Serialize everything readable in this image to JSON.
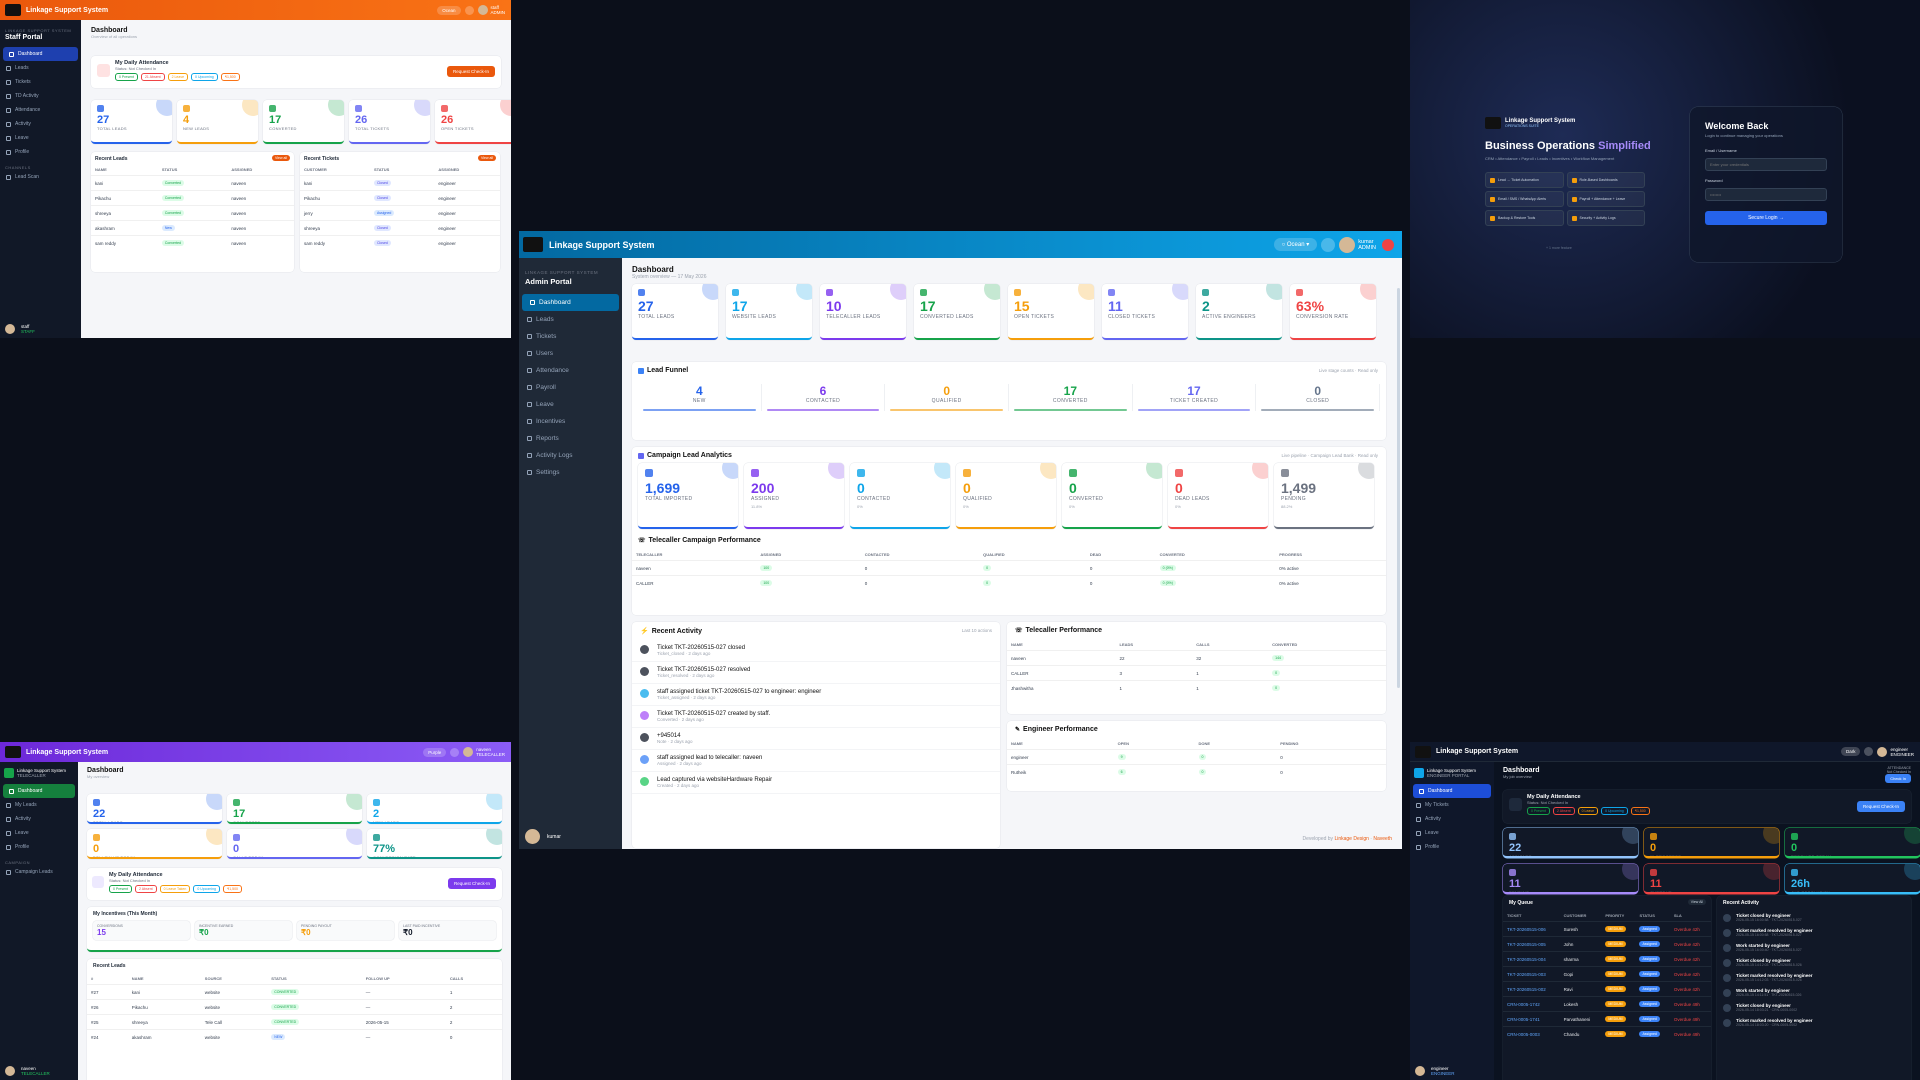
{
  "brand": "Linkage Support System",
  "staff": {
    "cap": "LINKAGE SUPPORT SYSTEM",
    "portal": "Staff Portal",
    "nav": [
      "Dashboard",
      "Leads",
      "Tickets",
      "TD Activity",
      "Attendance",
      "Activity",
      "Leave",
      "Profile"
    ],
    "nav_extra_cap": "CHANNELS",
    "nav_extra": "Lead Scan",
    "theme": "Ocean",
    "user": "staff",
    "role": "ADMIN",
    "title": "Dashboard",
    "subtitle": "Overview of all operations",
    "att_title": "My Daily Attendance",
    "att_status": "Status: Not Checked In",
    "att_chips": [
      "0 Present",
      "21 Absent",
      "2 Leave",
      "0 Upcoming",
      "₹1,500"
    ],
    "checkin": "Request Check-In",
    "stats": [
      {
        "n": "27",
        "l": "TOTAL LEADS",
        "c": "#2563eb"
      },
      {
        "n": "4",
        "l": "NEW LEADS",
        "c": "#f59e0b"
      },
      {
        "n": "17",
        "l": "CONVERTED",
        "c": "#16a34a"
      },
      {
        "n": "26",
        "l": "TOTAL TICKETS",
        "c": "#6366f1"
      },
      {
        "n": "26",
        "l": "OPEN TICKETS",
        "c": "#ef4444"
      }
    ],
    "recent_leads": "Recent Leads",
    "recent_tickets": "Recent Tickets",
    "view_all": "View all",
    "lead_cols": [
      "NAME",
      "STATUS",
      "ASSIGNED"
    ],
    "leads": [
      [
        "kani",
        "Converted",
        "naveen"
      ],
      [
        "Pikachu",
        "Converted",
        "naveen"
      ],
      [
        "shreeya",
        "Converted",
        "naveen"
      ],
      [
        "akashram",
        "New",
        "naveen"
      ],
      [
        "sam reddy",
        "Converted",
        "naveen"
      ]
    ],
    "ticket_cols": [
      "CUSTOMER",
      "STATUS",
      "ASSIGNED"
    ],
    "tickets": [
      [
        "kani",
        "Closed",
        "engineer"
      ],
      [
        "Pikachu",
        "Closed",
        "engineer"
      ],
      [
        "jerry",
        "Assigned",
        "engineer"
      ],
      [
        "shreeya",
        "Closed",
        "engineer"
      ],
      [
        "sam reddy",
        "Closed",
        "engineer"
      ]
    ],
    "footer_user": "staff",
    "footer_role": "STAFF"
  },
  "login": {
    "brand": "Linkage Support System",
    "tag": "OPERATIONS SUITE",
    "headline_a": "Business Operations",
    "headline_b": "Simplified",
    "desc": "CRM • Attendance • Payroll • Leads • Incentives • Workflow Management",
    "features": [
      "Lead → Ticket Automation",
      "Role-Based Dashboards",
      "Email / SMS / WhatsApp Alerts",
      "Payroll + Attendance + Leave",
      "Backup & Restore Tools",
      "Security + Activity Logs"
    ],
    "more": "+ 1 more feature",
    "welcome": "Welcome Back",
    "welcome_sub": "Login to continue managing your operations",
    "email_label": "Email / Username",
    "email_ph": "Enter your credentials",
    "pass_label": "Password",
    "pass_ph": "••••••••",
    "submit": "Secure Login"
  },
  "admin": {
    "cap": "LINKAGE SUPPORT SYSTEM",
    "portal": "Admin Portal",
    "nav": [
      "Dashboard",
      "Leads",
      "Tickets",
      "Users",
      "Attendance",
      "Payroll",
      "Leave",
      "Incentives",
      "Reports",
      "Activity Logs",
      "Settings"
    ],
    "theme": "Ocean",
    "user": "kumar",
    "role": "ADMIN",
    "title": "Dashboard",
    "subtitle": "System overview — 17 May 2026",
    "stats": [
      {
        "n": "27",
        "l": "TOTAL LEADS",
        "c": "#2563eb"
      },
      {
        "n": "17",
        "l": "WEBSITE LEADS",
        "c": "#0ea5e9"
      },
      {
        "n": "10",
        "l": "TELECALLER LEADS",
        "c": "#7c3aed"
      },
      {
        "n": "17",
        "l": "CONVERTED LEADS",
        "c": "#16a34a"
      },
      {
        "n": "15",
        "l": "OPEN TICKETS",
        "c": "#f59e0b"
      },
      {
        "n": "11",
        "l": "CLOSED TICKETS",
        "c": "#6366f1"
      },
      {
        "n": "2",
        "l": "ACTIVE ENGINEERS",
        "c": "#0d9488"
      },
      {
        "n": "63%",
        "l": "CONVERSION RATE",
        "c": "#ef4444"
      }
    ],
    "funnel_title": "Lead Funnel",
    "funnel_note": "Live stage counts · Read only",
    "funnel": [
      {
        "n": "4",
        "l": "NEW",
        "c": "#2563eb"
      },
      {
        "n": "6",
        "l": "CONTACTED",
        "c": "#7c3aed"
      },
      {
        "n": "0",
        "l": "QUALIFIED",
        "c": "#f59e0b"
      },
      {
        "n": "17",
        "l": "CONVERTED",
        "c": "#16a34a"
      },
      {
        "n": "17",
        "l": "TICKET CREATED",
        "c": "#6366f1"
      },
      {
        "n": "0",
        "l": "CLOSED",
        "c": "#64748b"
      }
    ],
    "campaign_title": "Campaign Lead Analytics",
    "campaign_note": "Live pipeline · Campaign Lead Bank · Read only",
    "campaign": [
      {
        "n": "1,699",
        "l": "TOTAL IMPORTED",
        "c": "#2563eb",
        "p": ""
      },
      {
        "n": "200",
        "l": "ASSIGNED",
        "c": "#7c3aed",
        "p": "11.8%"
      },
      {
        "n": "0",
        "l": "CONTACTED",
        "c": "#0ea5e9",
        "p": "0%"
      },
      {
        "n": "0",
        "l": "QUALIFIED",
        "c": "#f59e0b",
        "p": "0%"
      },
      {
        "n": "0",
        "l": "CONVERTED",
        "c": "#16a34a",
        "p": "0%"
      },
      {
        "n": "0",
        "l": "DEAD LEADS",
        "c": "#ef4444",
        "p": "0%"
      },
      {
        "n": "1,499",
        "l": "PENDING",
        "c": "#6b7280",
        "p": "88.2%"
      }
    ],
    "tcp_title": "Telecaller Campaign Performance",
    "tcp_cols": [
      "TELECALLER",
      "ASSIGNED",
      "CONTACTED",
      "QUALIFIED",
      "DEAD",
      "CONVERTED",
      "PROGRESS"
    ],
    "tcp_rows": [
      [
        "naveen",
        "100",
        "0",
        "0",
        "0",
        "0 (0%)",
        "0% active"
      ],
      [
        "CALLER",
        "100",
        "0",
        "0",
        "0",
        "0 (0%)",
        "0% active"
      ]
    ],
    "activity_title": "Recent Activity",
    "activity_note": "Last 10 actions",
    "activity": [
      {
        "t": "Ticket TKT-20260515-027 closed",
        "s": "Ticket_closed · 2 days ago"
      },
      {
        "t": "Ticket TKT-20260515-027 resolved",
        "s": "Ticket_resolved · 2 days ago"
      },
      {
        "t": "staff assigned ticket TKT-20260515-027 to engineer: engineer",
        "s": "Ticket_assigned · 2 days ago"
      },
      {
        "t": "Ticket TKT-20260515-027 created by staff.",
        "s": "Converted · 2 days ago"
      },
      {
        "t": "+945014",
        "s": "Note · 2 days ago"
      },
      {
        "t": "staff assigned lead to telecaller: naveen",
        "s": "Assigned · 2 days ago"
      },
      {
        "t": "Lead captured via websiteHardware Repair",
        "s": "Created · 2 days ago"
      }
    ],
    "tp_title": "Telecaller Performance",
    "tp_cols": [
      "NAME",
      "LEADS",
      "CALLS",
      "CONVERTED"
    ],
    "tp_rows": [
      [
        "naveen",
        "22",
        "32",
        "144"
      ],
      [
        "CALLER",
        "3",
        "1",
        "0"
      ],
      [
        "Jhashwitha",
        "1",
        "1",
        "0"
      ]
    ],
    "ep_title": "Engineer Performance",
    "ep_cols": [
      "NAME",
      "OPEN",
      "DONE",
      "PENDING"
    ],
    "ep_rows": [
      [
        "engineer",
        "9",
        "0",
        "0"
      ],
      [
        "Rutheik",
        "6",
        "0",
        "0"
      ]
    ],
    "footer": "Developed by",
    "footer_a": "Linkage Design",
    "footer_b": "Naveeth",
    "footer_user": "kumar"
  },
  "tele": {
    "title_brand": "Linkage Support System",
    "side_brand": "Linkage Support System",
    "side_role": "TELECALLER",
    "nav": [
      "Dashboard",
      "My Leads",
      "Activity",
      "Leave",
      "Profile"
    ],
    "nav_cap": "CAMPAIGN",
    "nav_extra": "Campaign Leads",
    "theme": "Purple",
    "user": "naveen",
    "role": "TELECALLER",
    "title": "Dashboard",
    "subtitle": "My overview",
    "stats": [
      {
        "n": "22",
        "l": "TOTAL LEADS",
        "c": "#2563eb"
      },
      {
        "n": "17",
        "l": "CONVERTED",
        "c": "#16a34a"
      },
      {
        "n": "2",
        "l": "NEW LEADS",
        "c": "#0ea5e9"
      },
      {
        "n": "0",
        "l": "FOLLOW UP TODAY",
        "c": "#f59e0b"
      },
      {
        "n": "0",
        "l": "CALLS TODAY",
        "c": "#6366f1"
      },
      {
        "n": "77%",
        "l": "CONVERSION RATE",
        "c": "#0d9488"
      }
    ],
    "att_title": "My Daily Attendance",
    "att_status": "Status: Not Checked In",
    "att_chips": [
      "0 Present",
      "2 Absent",
      "0 Leave Taken",
      "0 Upcoming",
      "₹1,500"
    ],
    "checkin": "Request Check-In",
    "inc_title": "My Incentives (This Month)",
    "inc": [
      {
        "l": "CONVERSIONS",
        "n": "15",
        "c": "#7c3aed"
      },
      {
        "l": "INCENTIVE EARNED",
        "n": "₹0",
        "c": "#16a34a"
      },
      {
        "l": "PENDING PAYOUT",
        "n": "₹0",
        "c": "#f59e0b"
      },
      {
        "l": "LAST PAID INCENTIVE",
        "n": "₹0",
        "c": "#111827"
      }
    ],
    "rl_title": "Recent Leads",
    "rl_cols": [
      "#",
      "NAME",
      "SOURCE",
      "STATUS",
      "FOLLOW UP",
      "CALLS"
    ],
    "rl_rows": [
      [
        "#27",
        "kani",
        "website",
        "CONVERTED",
        "—",
        "1"
      ],
      [
        "#26",
        "Pikachu",
        "website",
        "CONVERTED",
        "—",
        "2"
      ],
      [
        "#25",
        "shreeya",
        "Tele Call",
        "CONVERTED",
        "2026-05-15",
        "2"
      ],
      [
        "#24",
        "akashram",
        "website",
        "NEW",
        "—",
        "0"
      ]
    ],
    "footer_user": "naveen",
    "footer_role": "TELECALLER"
  },
  "eng": {
    "brand": "Linkage Support System",
    "side_brand": "Linkage Support System",
    "side_role": "ENGINEER PORTAL",
    "nav": [
      "Dashboard",
      "My Tickets",
      "Activity",
      "Leave",
      "Profile"
    ],
    "theme": "Dark",
    "user": "engineer",
    "role": "ENGINEER",
    "title": "Dashboard",
    "subtitle": "My job overview",
    "att_side": "ATTENDANCE",
    "att_side2": "Not Checked In",
    "att_btn": "Check In",
    "att_title": "My Daily Attendance",
    "att_status": "Status: Not Checked In",
    "att_chips": [
      "0 Present",
      "2 Absent",
      "0 Leave",
      "0 Upcoming",
      "₹1,500"
    ],
    "checkin": "Request Check-In",
    "stats": [
      {
        "n": "22",
        "l": "ASSIGNED",
        "c": "#93c5fd"
      },
      {
        "n": "0",
        "l": "IN PROGRESS",
        "c": "#f59e0b"
      },
      {
        "n": "0",
        "l": "RESOLVED TODAY",
        "c": "#22c55e"
      },
      {
        "n": "11",
        "l": "PENDING",
        "c": "#a78bfa"
      },
      {
        "n": "11",
        "l": "OVERDUE",
        "c": "#ef4444"
      },
      {
        "n": "26h",
        "l": "AVG RESOLUTION",
        "c": "#38bdf8"
      }
    ],
    "queue_title": "My Queue",
    "queue_btn": "View All",
    "queue_cols": [
      "TICKET",
      "CUSTOMER",
      "PRIORITY",
      "STATUS",
      "SLA"
    ],
    "queue": [
      [
        "TKT-20260515-006",
        "Suresh",
        "MEDIUM",
        "Assigned",
        "Overdue 42h"
      ],
      [
        "TKT-20260515-005",
        "John",
        "MEDIUM",
        "Assigned",
        "Overdue 42h"
      ],
      [
        "TKT-20260515-004",
        "sharma",
        "MEDIUM",
        "Assigned",
        "Overdue 42h"
      ],
      [
        "TKT-20260515-003",
        "Gopi",
        "MEDIUM",
        "Assigned",
        "Overdue 42h"
      ],
      [
        "TKT-20260515-002",
        "Ravi",
        "MEDIUM",
        "Assigned",
        "Overdue 42h"
      ],
      [
        "CRN-0005-1742",
        "Lokesh",
        "MEDIUM",
        "Assigned",
        "Overdue 49h"
      ],
      [
        "CRN-0005-1741",
        "Parvathaneni",
        "MEDIUM",
        "Assigned",
        "Overdue 49h"
      ],
      [
        "CRN-0005-0003",
        "Chandu",
        "MEDIUM",
        "Assigned",
        "Overdue 49h"
      ]
    ],
    "ra_title": "Recent Activity",
    "ra": [
      [
        "Ticket closed by engineer",
        "2026-05-15 16:00:58 · TKT-20260515-027"
      ],
      [
        "Ticket marked resolved by engineer",
        "2026-05-15 16:00:58 · TKT-20260515-027"
      ],
      [
        "Work started by engineer",
        "2026-05-15 16:00:40 · TKT-20260515-027"
      ],
      [
        "Ticket closed by engineer",
        "2026-05-15 14:12:03 · TKT-20260515-026"
      ],
      [
        "Ticket marked resolved by engineer",
        "2026-05-15 14:12:03 · TKT-20260515-026"
      ],
      [
        "Work started by engineer",
        "2026-05-15 14:11:51 · TKT-20260515-026"
      ],
      [
        "Ticket closed by engineer",
        "2026-05-14 18:03:21 · CRN-0005-0002"
      ],
      [
        "Ticket marked resolved by engineer",
        "2026-05-14 18:03:20 · CRN-0005-0002"
      ]
    ],
    "footer_user": "engineer",
    "footer_role": "ENGINEER"
  }
}
